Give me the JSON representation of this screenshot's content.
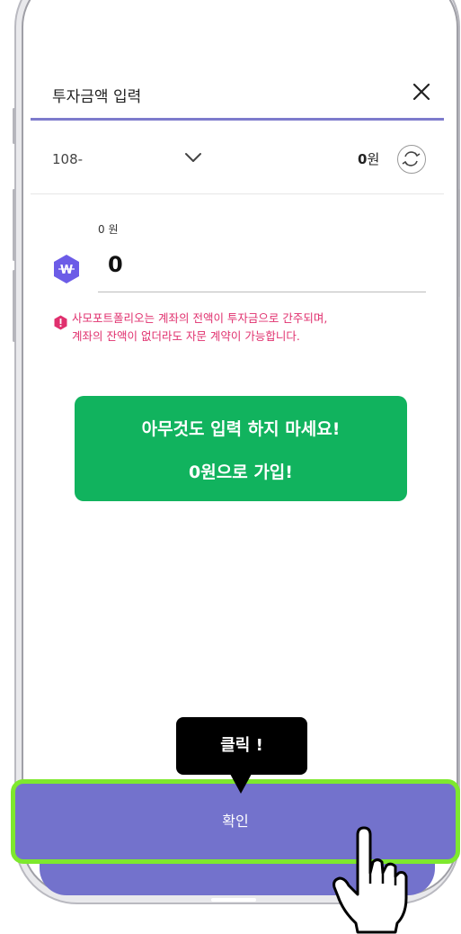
{
  "header": {
    "title": "투자금액 입력"
  },
  "account": {
    "number": "108-",
    "balance_value": "0",
    "balance_unit": "원"
  },
  "amount": {
    "label": "0 원",
    "value": "0"
  },
  "notice": {
    "line1": "사모포트폴리오는 계좌의 전액이 투자금으로 간주되며,",
    "line2": "계좌의 잔액이 없더라도 자문 계약이 가능합니다."
  },
  "callout": {
    "line1": "아무것도 입력 하지 마세요!",
    "line2": "0원으로 가입!"
  },
  "tooltip": {
    "label": "클릭 !"
  },
  "confirm": {
    "label": "확인"
  },
  "colors": {
    "accent": "#7372cc",
    "callout": "#11b35e",
    "warning": "#e0306e",
    "highlight": "#7ee82e"
  },
  "icons": [
    "close-icon",
    "chevron-down-icon",
    "refresh-icon",
    "won-hexagon-icon",
    "warning-icon",
    "pointing-hand-icon"
  ]
}
